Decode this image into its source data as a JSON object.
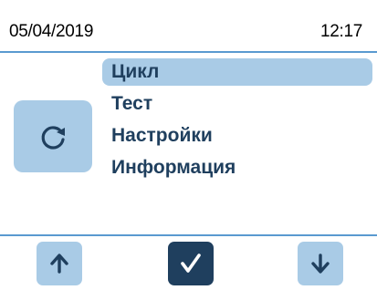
{
  "status": {
    "date": "05/04/2019",
    "time": "12:17"
  },
  "menu": {
    "items": [
      {
        "label": "Цикл",
        "selected": true
      },
      {
        "label": "Тест",
        "selected": false
      },
      {
        "label": "Настройки",
        "selected": false
      },
      {
        "label": "Информация",
        "selected": false
      }
    ]
  },
  "icons": {
    "cycle": "refresh-icon",
    "up": "arrow-up-icon",
    "ok": "checkmark-icon",
    "down": "arrow-down-icon"
  },
  "colors": {
    "accent_light": "#a9cbe6",
    "accent_dark": "#1f3f5e",
    "divider": "#5a9ad0"
  }
}
